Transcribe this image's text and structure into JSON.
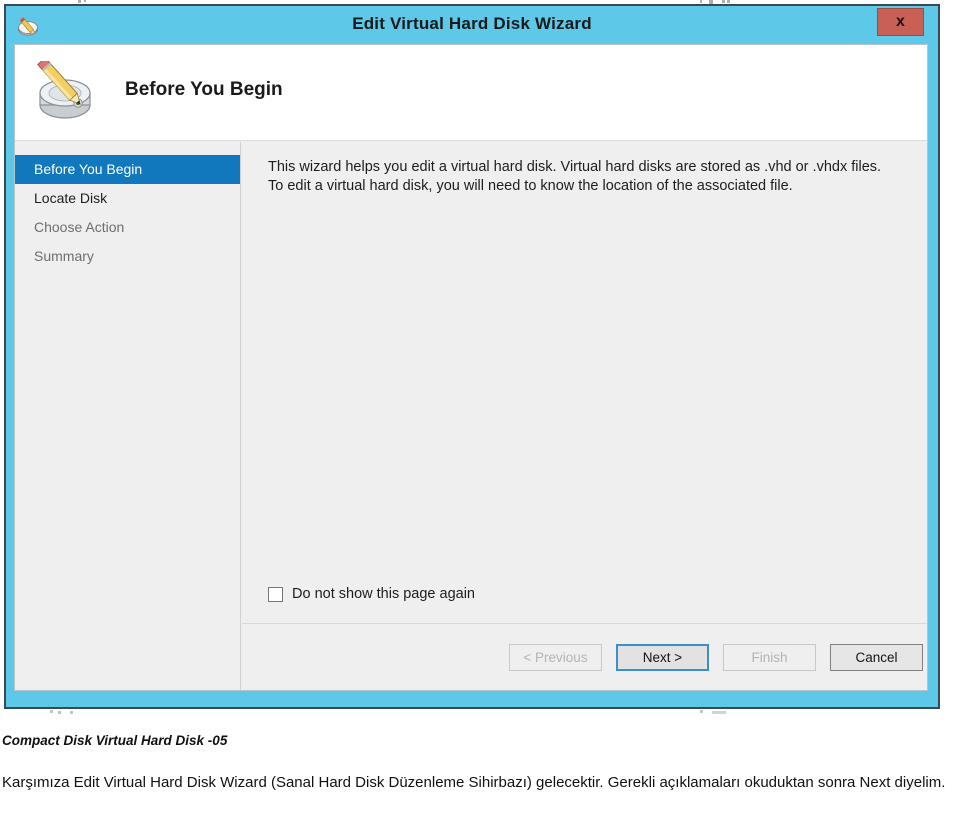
{
  "window": {
    "title": "Edit Virtual Hard Disk Wizard",
    "title_icon": "disk-pencil-icon",
    "close_label": "x",
    "titlebar_color": "#5ec8e8",
    "close_color": "#c96055"
  },
  "banner": {
    "title": "Before You Begin",
    "icon": "hard-disk-pencil-icon"
  },
  "sidebar": {
    "items": [
      {
        "label": "Before You Begin",
        "state": "selected"
      },
      {
        "label": "Locate Disk",
        "state": "visited"
      },
      {
        "label": "Choose Action",
        "state": "pending"
      },
      {
        "label": "Summary",
        "state": "pending"
      }
    ],
    "selected_color": "#1278be"
  },
  "content": {
    "intro_text": "This wizard helps you edit a virtual hard disk. Virtual hard disks are stored as .vhd or .vhdx files. To edit a virtual hard disk, you will need to know the location of the associated file.",
    "checkbox": {
      "label": "Do not show this page again",
      "checked": false
    }
  },
  "buttons": {
    "previous": {
      "label": "< Previous",
      "enabled": false
    },
    "next": {
      "label": "Next >",
      "enabled": true,
      "focused": true
    },
    "finish": {
      "label": "Finish",
      "enabled": false
    },
    "cancel": {
      "label": "Cancel",
      "enabled": true
    }
  },
  "caption": {
    "heading": "Compact Disk Virtual Hard Disk -05",
    "paragraph": "Karşımıza Edit Virtual Hard Disk Wizard (Sanal Hard Disk Düzenleme Sihirbazı) gelecektir. Gerekli açıklamaları okuduktan sonra Next diyelim."
  }
}
